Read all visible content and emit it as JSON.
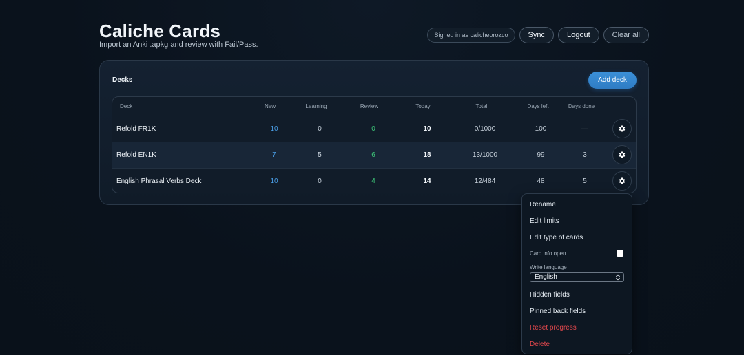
{
  "header": {
    "title": "Caliche Cards",
    "subtitle": "Import an Anki .apkg and review with Fail/Pass.",
    "signed_in": "Signed in as calicheorozco",
    "sync": "Sync",
    "logout": "Logout",
    "clear_all": "Clear all"
  },
  "panel": {
    "title": "Decks",
    "add_deck": "Add deck"
  },
  "table": {
    "headers": [
      "Deck",
      "New",
      "Learning",
      "Review",
      "Today",
      "Total",
      "Days left",
      "Days done"
    ],
    "rows": [
      {
        "deck": "Refold FR1K",
        "new": "10",
        "learning": "0",
        "review": "0",
        "today": "10",
        "total": "0/1000",
        "days_left": "100",
        "days_done": "—"
      },
      {
        "deck": "Refold EN1K",
        "new": "7",
        "learning": "5",
        "review": "6",
        "today": "18",
        "total": "13/1000",
        "days_left": "99",
        "days_done": "3"
      },
      {
        "deck": "English Phrasal Verbs Deck",
        "new": "10",
        "learning": "0",
        "review": "4",
        "today": "14",
        "total": "12/484",
        "days_left": "48",
        "days_done": "5"
      }
    ]
  },
  "menu": {
    "rename": "Rename",
    "edit_limits": "Edit limits",
    "edit_type": "Edit type of cards",
    "card_info_open": "Card info open",
    "write_language": "Write language",
    "language_value": "English",
    "hidden_fields": "Hidden fields",
    "pinned_back_fields": "Pinned back fields",
    "reset_progress": "Reset progress",
    "delete": "Delete"
  },
  "icons": {
    "row_settings": "gear-icon",
    "select_arrow": "chevron-updown-icon"
  },
  "colors": {
    "accent": "#3b90d8",
    "new": "#4a9fe8",
    "review": "#3ec97a",
    "danger": "#e5484d"
  }
}
